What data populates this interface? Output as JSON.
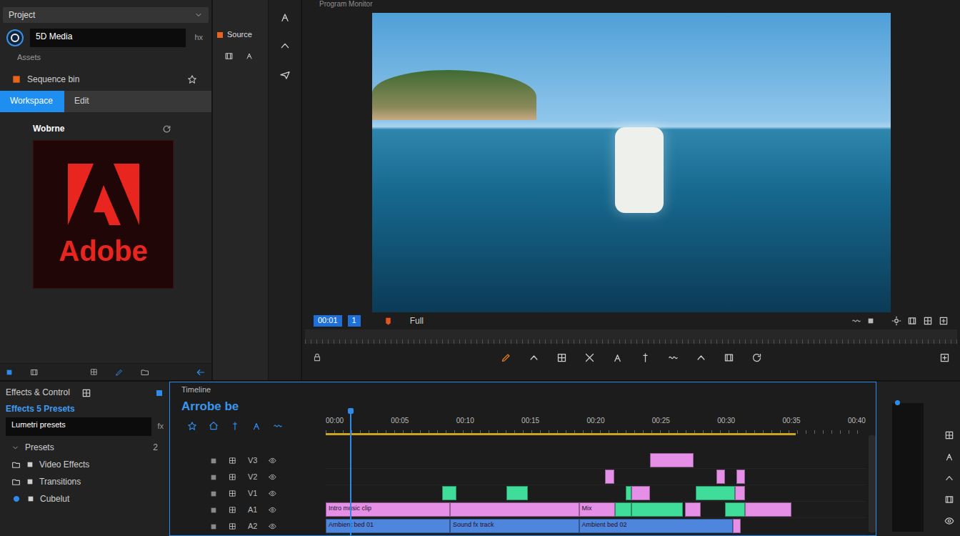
{
  "project": {
    "header": "Project",
    "search_label": "5D Media",
    "search_badge": "hx",
    "subtitle": "Assets",
    "bin": "Sequence bin",
    "tabs": [
      {
        "label": "Workspace",
        "selected": true
      },
      {
        "label": "Edit",
        "selected": false
      }
    ],
    "asset_title": "Wobrne",
    "logo": "Adobe"
  },
  "source": {
    "title": "Source"
  },
  "monitor": {
    "title": "Program Monitor",
    "timecode": "00:01",
    "marker": "1",
    "quality": "Full"
  },
  "effects": {
    "header": "Effects & Control",
    "category": "Effects 5 Presets",
    "search_value": "Lumetri presets",
    "search_badge": "fx",
    "items": [
      {
        "label": "Presets",
        "count": "2",
        "kind": "group"
      },
      {
        "label": "Video Effects",
        "kind": "folder"
      },
      {
        "label": "Transitions",
        "kind": "folder"
      },
      {
        "label": "Cubelut",
        "kind": "preset"
      }
    ]
  },
  "timeline": {
    "header": "Timeline",
    "sequence": "Arrobe be",
    "ruler": [
      "00:00",
      "00:05",
      "00:10",
      "00:15",
      "00:20",
      "00:25",
      "00:30",
      "00:35",
      "00:40"
    ],
    "length": 100,
    "playhead": {
      "level": 0.045
    },
    "work_area": {
      "level": 0.87
    },
    "tracks": [
      {
        "name": "V3",
        "clips": [
          {
            "start": 60.1,
            "end": 68.1,
            "color": "#e58fe6"
          }
        ]
      },
      {
        "name": "V2",
        "clips": [
          {
            "start": 51.7,
            "end": 53.5,
            "color": "#e58fe6"
          },
          {
            "start": 72.3,
            "end": 73.9,
            "color": "#e58fe6"
          },
          {
            "start": 76.0,
            "end": 77.7,
            "color": "#e58fe6"
          }
        ]
      },
      {
        "name": "V1",
        "clips": [
          {
            "start": 21.5,
            "end": 24.2,
            "color": "#3fdc9a"
          },
          {
            "start": 33.4,
            "end": 37.5,
            "color": "#3fdc9a"
          },
          {
            "start": 55.6,
            "end": 56.6,
            "color": "#3fdc9a"
          },
          {
            "start": 56.6,
            "end": 60.1,
            "color": "#e58fe6"
          },
          {
            "start": 68.5,
            "end": 75.8,
            "color": "#3fdc9a"
          },
          {
            "start": 75.8,
            "end": 77.7,
            "color": "#e58fe6"
          }
        ]
      },
      {
        "name": "A1",
        "clips": [
          {
            "start": 0,
            "end": 23.0,
            "color": "#e58fe6",
            "label": "Intro music clip"
          },
          {
            "start": 23.0,
            "end": 46.9,
            "color": "#e58fe6"
          },
          {
            "start": 46.9,
            "end": 53.6,
            "color": "#e58fe6",
            "label": "Mix"
          },
          {
            "start": 53.6,
            "end": 56.6,
            "color": "#3fdc9a"
          },
          {
            "start": 56.6,
            "end": 66.2,
            "color": "#3fdc9a"
          },
          {
            "start": 66.5,
            "end": 69.4,
            "color": "#e58fe6"
          },
          {
            "start": 74.0,
            "end": 77.7,
            "color": "#3fdc9a"
          },
          {
            "start": 77.7,
            "end": 86.2,
            "color": "#e58fe6"
          }
        ]
      },
      {
        "name": "A2",
        "clips": [
          {
            "start": 0,
            "end": 23.0,
            "color": "#4d86dc",
            "label": "Ambient bed 01"
          },
          {
            "start": 23.0,
            "end": 46.9,
            "color": "#4d86dc",
            "label": "Sound fx track"
          },
          {
            "start": 46.9,
            "end": 75.4,
            "color": "#4d86dc",
            "label": "Ambient bed 02"
          },
          {
            "start": 75.4,
            "end": 76.8,
            "color": "#e58fe6"
          }
        ]
      }
    ]
  }
}
